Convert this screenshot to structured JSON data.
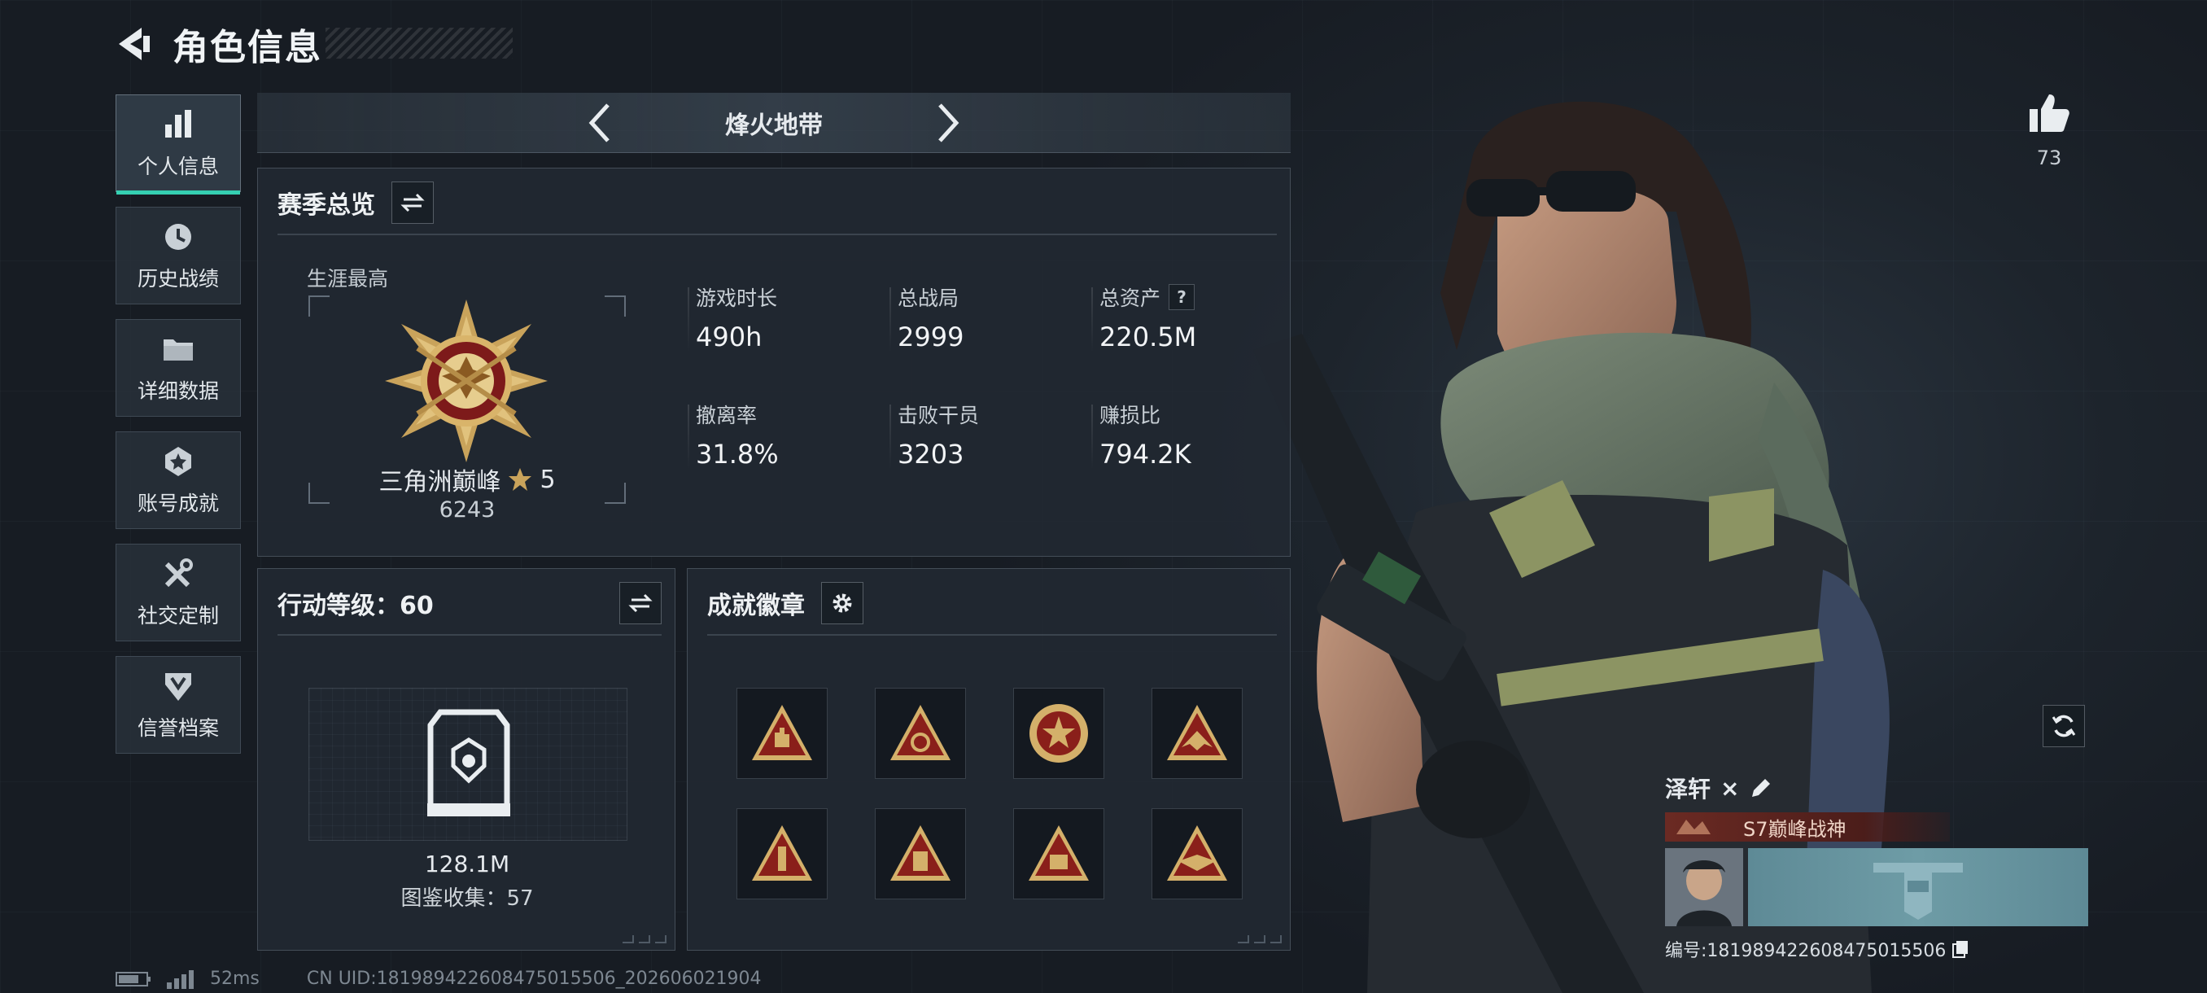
{
  "header": {
    "title": "角色信息"
  },
  "sidebar": {
    "items": [
      {
        "label": "个人信息",
        "icon": "bar-chart-icon",
        "active": true
      },
      {
        "label": "历史战绩",
        "icon": "history-icon",
        "active": false
      },
      {
        "label": "详细数据",
        "icon": "folder-icon",
        "active": false
      },
      {
        "label": "账号成就",
        "icon": "achievement-icon",
        "active": false
      },
      {
        "label": "社交定制",
        "icon": "tools-icon",
        "active": false
      },
      {
        "label": "信誉档案",
        "icon": "shield-icon",
        "active": false
      }
    ]
  },
  "mode": {
    "title": "烽火地带"
  },
  "season": {
    "title": "赛季总览",
    "career_label": "生涯最高",
    "rank_name": "三角洲巅峰",
    "rank_stars": "5",
    "rank_score": "6243",
    "stats": [
      {
        "label": "游戏时长",
        "value": "490h"
      },
      {
        "label": "总战局",
        "value": "2999"
      },
      {
        "label": "总资产",
        "value": "220.5M",
        "help": "?"
      },
      {
        "label": "撤离率",
        "value": "31.8%"
      },
      {
        "label": "击败干员",
        "value": "3203"
      },
      {
        "label": "赚损比",
        "value": "794.2K"
      }
    ]
  },
  "action": {
    "title": "行动等级：60",
    "collection_value": "128.1M",
    "collection_count": "图鉴收集：57"
  },
  "badges": {
    "title": "成就徽章",
    "count": 8
  },
  "like": {
    "count": "73"
  },
  "player": {
    "name": "泽轩",
    "name_suffix": "×",
    "title": "S7巅峰战神",
    "uid": "编号:18198942260847501550​6"
  },
  "status": {
    "ping": "52ms",
    "uid_line": "CN UID:18198942260847501550​6_202606021904"
  },
  "colors": {
    "accent": "#35d0b2",
    "badge_red": "#8a1f1a",
    "badge_gold": "#d4b06a"
  }
}
